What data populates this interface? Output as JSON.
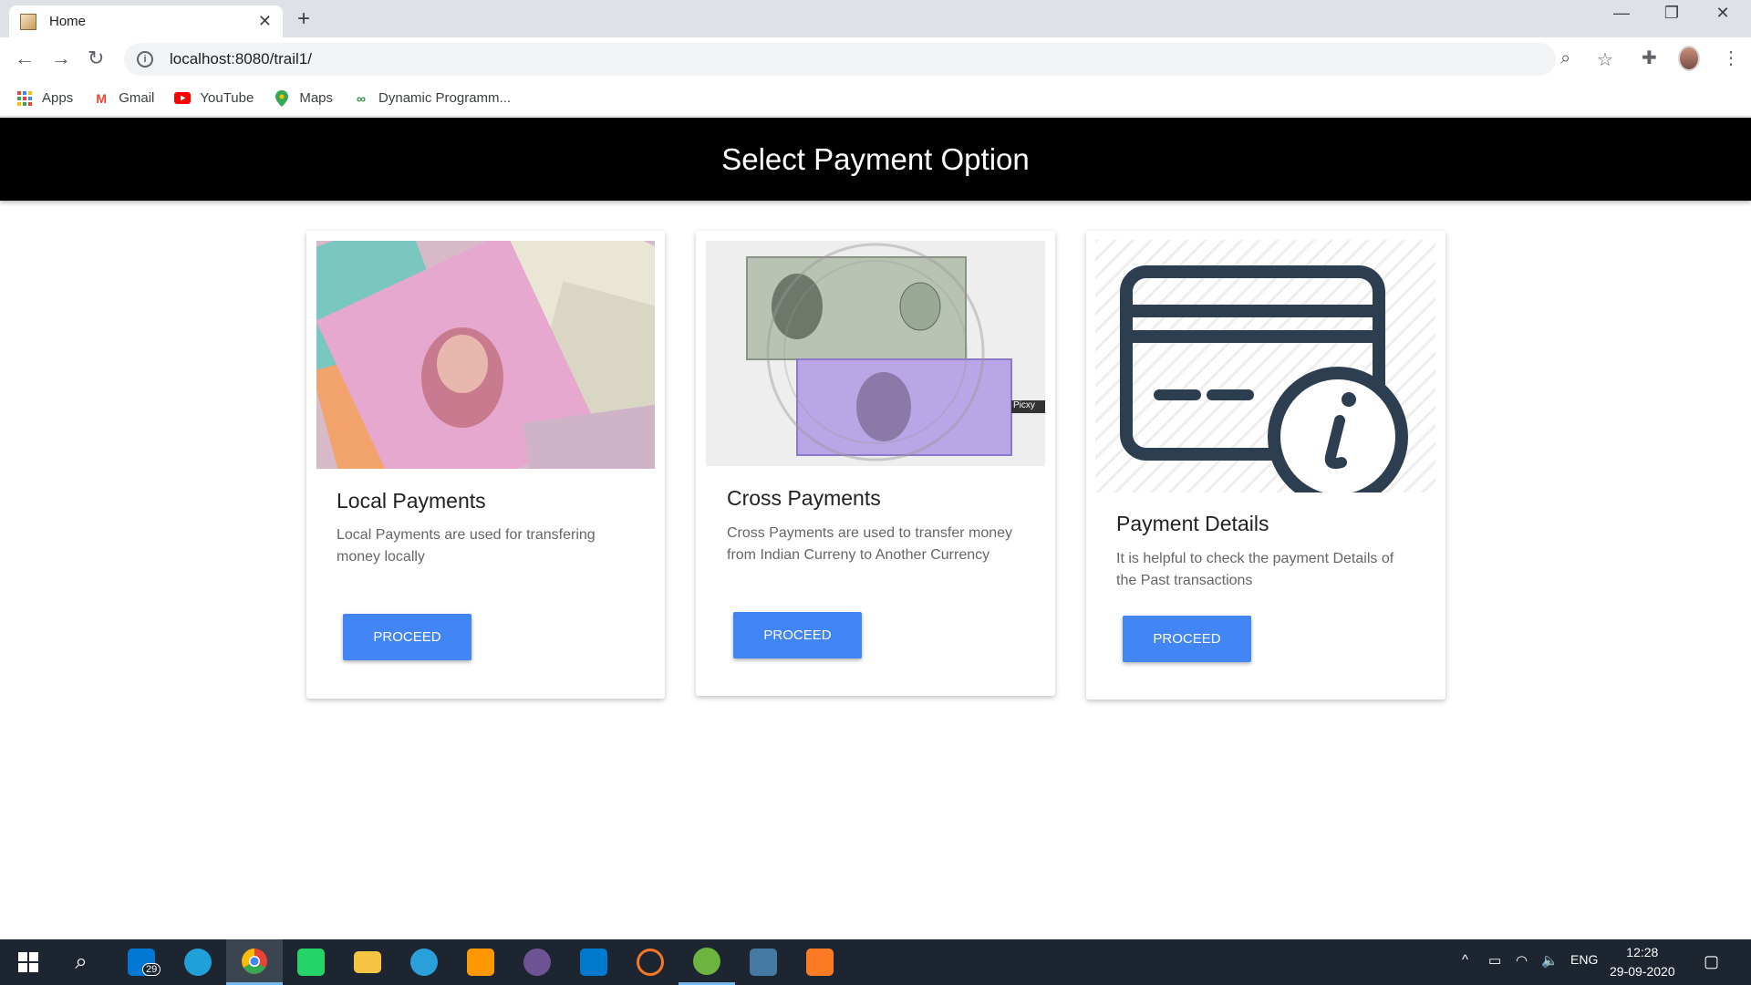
{
  "browser": {
    "tab_title": "Home",
    "url": "localhost:8080/trail1/",
    "bookmarks": [
      {
        "label": "Apps",
        "icon": "apps-grid-icon"
      },
      {
        "label": "Gmail",
        "icon": "gmail-icon"
      },
      {
        "label": "YouTube",
        "icon": "youtube-icon"
      },
      {
        "label": "Maps",
        "icon": "maps-icon"
      },
      {
        "label": "Dynamic Programm...",
        "icon": "gfg-icon"
      }
    ]
  },
  "page": {
    "header_title": "Select Payment Option",
    "cards": [
      {
        "title": "Local Payments",
        "description": "Local Payments are used for transfering money locally",
        "button": "PROCEED"
      },
      {
        "title": "Cross Payments",
        "description": "Cross Payments are used to transfer money from Indian Curreny to Another Currency",
        "button": "PROCEED",
        "image_badge": "Picxy"
      },
      {
        "title": "Payment Details",
        "description": "It is helpful to check the payment Details of the Past transactions",
        "button": "PROCEED"
      }
    ]
  },
  "taskbar": {
    "mail_badge": "29",
    "language": "ENG",
    "time": "12:28",
    "date": "29-09-2020"
  },
  "colors": {
    "accent": "#4285f4",
    "header_bg": "#000000",
    "taskbar_bg": "#1d2630",
    "card_icon": "#2d3e50"
  }
}
